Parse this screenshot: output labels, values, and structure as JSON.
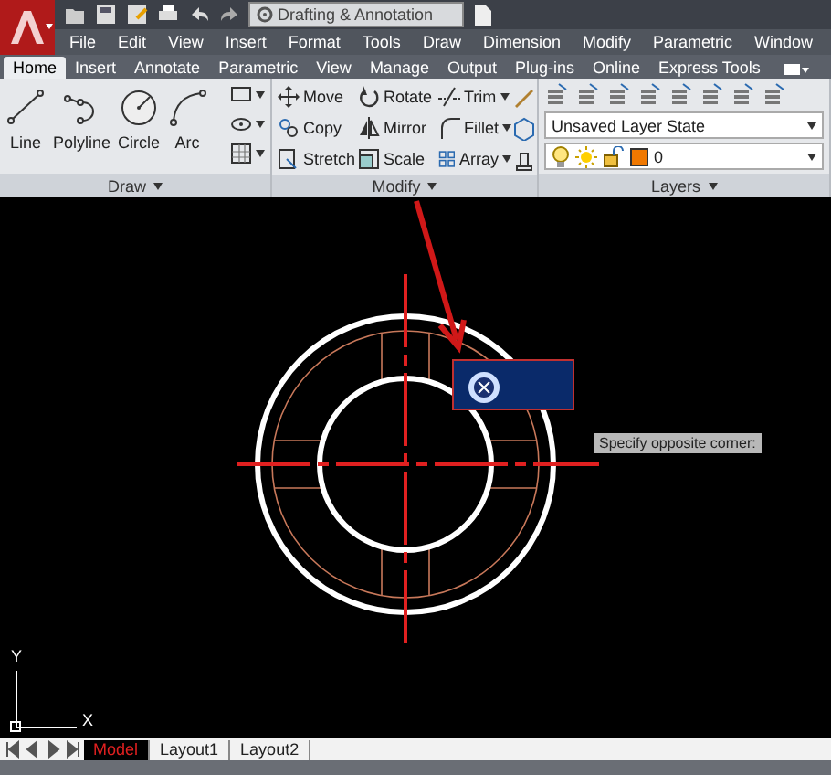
{
  "quick_access": {
    "workspace": "Drafting & Annotation"
  },
  "menu": [
    "File",
    "Edit",
    "View",
    "Insert",
    "Format",
    "Tools",
    "Draw",
    "Dimension",
    "Modify",
    "Parametric",
    "Window"
  ],
  "ribbon_tabs": [
    {
      "label": "Home",
      "selected": true
    },
    {
      "label": "Insert",
      "selected": false
    },
    {
      "label": "Annotate",
      "selected": false
    },
    {
      "label": "Parametric",
      "selected": false
    },
    {
      "label": "View",
      "selected": false
    },
    {
      "label": "Manage",
      "selected": false
    },
    {
      "label": "Output",
      "selected": false
    },
    {
      "label": "Plug-ins",
      "selected": false
    },
    {
      "label": "Online",
      "selected": false
    },
    {
      "label": "Express Tools",
      "selected": false
    }
  ],
  "draw_panel": {
    "title": "Draw",
    "tools": [
      {
        "kind": "line",
        "label": "Line"
      },
      {
        "kind": "polyline",
        "label": "Polyline"
      },
      {
        "kind": "circle",
        "label": "Circle"
      },
      {
        "kind": "arc",
        "label": "Arc"
      }
    ]
  },
  "modify_panel": {
    "title": "Modify",
    "tools": [
      {
        "kind": "move",
        "label": "Move"
      },
      {
        "kind": "rotate",
        "label": "Rotate"
      },
      {
        "kind": "trim",
        "label": "Trim"
      },
      {
        "kind": "copy",
        "label": "Copy"
      },
      {
        "kind": "mirror",
        "label": "Mirror"
      },
      {
        "kind": "fillet",
        "label": "Fillet"
      },
      {
        "kind": "stretch",
        "label": "Stretch"
      },
      {
        "kind": "scale",
        "label": "Scale"
      },
      {
        "kind": "array",
        "label": "Array"
      }
    ]
  },
  "layers_panel": {
    "title": "Layers",
    "layer_state": "Unsaved Layer State",
    "current_layer": "0"
  },
  "canvas": {
    "tooltip": "Specify opposite corner:",
    "ucs_y": "Y",
    "ucs_x": "X"
  },
  "layout_tabs": [
    {
      "label": "Model",
      "selected": true
    },
    {
      "label": "Layout1",
      "selected": false
    },
    {
      "label": "Layout2",
      "selected": false
    }
  ]
}
